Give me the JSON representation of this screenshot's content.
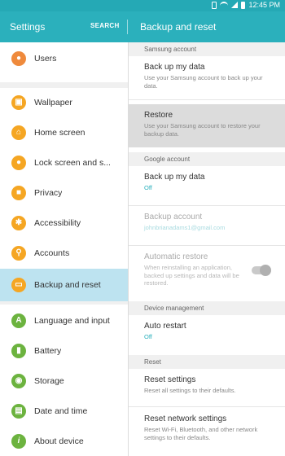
{
  "status": {
    "time": "12:45 PM"
  },
  "app_bar": {
    "title": "Settings",
    "search_label": "SEARCH",
    "detail_title": "Backup and reset"
  },
  "colors": {
    "accent": "#2bb0bc",
    "selected": "#bde3f0"
  },
  "nav": {
    "items": [
      {
        "label": "Users",
        "icon": "users-icon",
        "color": "#ef8a3c"
      },
      {
        "label": "Wallpaper",
        "icon": "wallpaper-icon",
        "color": "#f5a623"
      },
      {
        "label": "Home screen",
        "icon": "home-icon",
        "color": "#f5a623"
      },
      {
        "label": "Lock screen and s...",
        "icon": "lock-icon",
        "color": "#f5a623"
      },
      {
        "label": "Privacy",
        "icon": "privacy-icon",
        "color": "#f5a623"
      },
      {
        "label": "Accessibility",
        "icon": "accessibility-icon",
        "color": "#f5a623"
      },
      {
        "label": "Accounts",
        "icon": "key-icon",
        "color": "#f5a623"
      },
      {
        "label": "Backup and reset",
        "icon": "backup-icon",
        "color": "#f5a623"
      },
      {
        "label": "Language and input",
        "icon": "language-icon",
        "color": "#6cb33f"
      },
      {
        "label": "Battery",
        "icon": "battery-icon",
        "color": "#6cb33f"
      },
      {
        "label": "Storage",
        "icon": "storage-icon",
        "color": "#6cb33f"
      },
      {
        "label": "Date and time",
        "icon": "date-time-icon",
        "color": "#6cb33f"
      },
      {
        "label": "About device",
        "icon": "info-icon",
        "color": "#6cb33f"
      }
    ]
  },
  "detail": {
    "samsung_account": {
      "header": "Samsung account",
      "backup": {
        "title": "Back up my data",
        "subtitle": "Use your Samsung account to back up your data."
      },
      "restore": {
        "title": "Restore",
        "subtitle": "Use your Samsung account to restore your backup data."
      }
    },
    "google_account": {
      "header": "Google account",
      "backup": {
        "title": "Back up my data",
        "subtitle": "Off"
      },
      "backup_account": {
        "title": "Backup account",
        "subtitle": "johnbrianadams1@gmail.com"
      },
      "auto_restore": {
        "title": "Automatic restore",
        "subtitle": "When reinstalling an application, backed up settings and data will be restored.",
        "toggle_on": true
      }
    },
    "device_management": {
      "header": "Device management",
      "auto_restart": {
        "title": "Auto restart",
        "subtitle": "Off"
      }
    },
    "reset": {
      "header": "Reset",
      "reset_settings": {
        "title": "Reset settings",
        "subtitle": "Reset all settings to their defaults."
      },
      "reset_network": {
        "title": "Reset network settings",
        "subtitle": "Reset Wi-Fi, Bluetooth, and other network settings to their defaults."
      }
    }
  }
}
